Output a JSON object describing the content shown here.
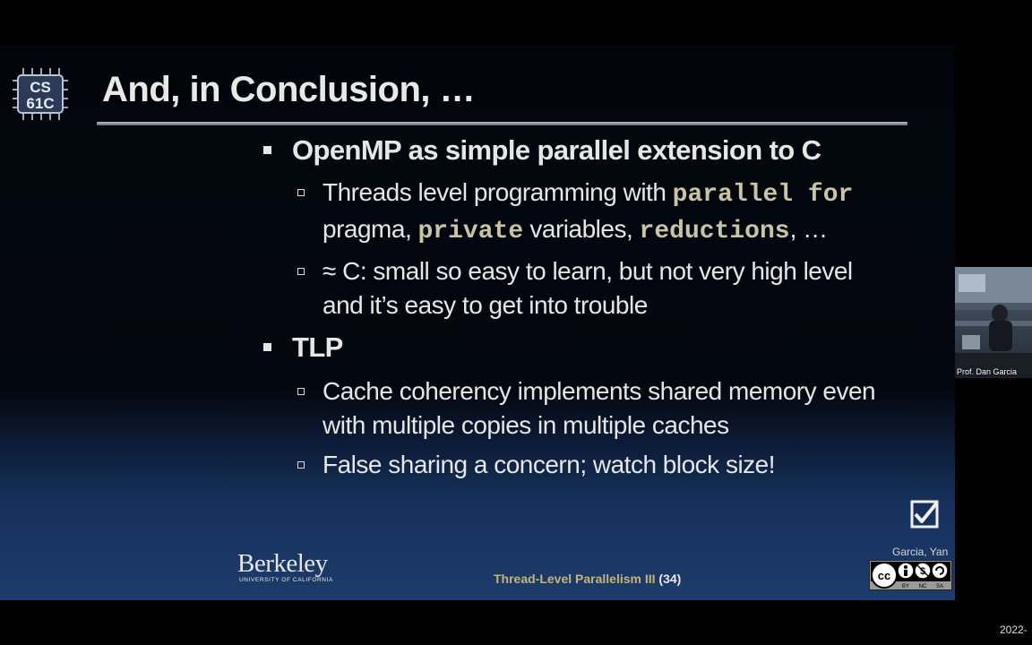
{
  "slide": {
    "logo_text_line1": "CS",
    "logo_text_line2": "61C",
    "title": "And, in Conclusion, …",
    "bullets": {
      "openmp": {
        "text": "OpenMP as simple parallel extension to C",
        "threads": {
          "part1": "Threads level programming with ",
          "code_parallel_for": "parallel for",
          "part2": " pragma, ",
          "code_private": "private",
          "part3": " variables, ",
          "code_reductions": "reductions",
          "part4": ", …"
        },
        "approx": "≈ C: small so easy to learn, but not very high level and it’s easy to get into trouble"
      },
      "tlp": {
        "text": "TLP",
        "cache": "Cache coherency implements shared memory even with multiple copies in multiple caches",
        "false_sharing": "False sharing a concern; watch block size!"
      }
    },
    "checkbox_glyph": "☑",
    "berkeley_name": "Berkeley",
    "berkeley_sub": "UNIVERSITY OF CALIFORNIA",
    "footer_title": "Thread-Level Parallelism III",
    "footer_page": "(34)",
    "authors": "Garcia, Yan",
    "cc_labels": [
      "BY",
      "NC",
      "SA"
    ]
  },
  "webcam": {
    "label": "Prof. Dan Garcia"
  },
  "timestamp": "2022-",
  "colors": {
    "text": "#e6e6e6",
    "code": "#c9c4a3",
    "footer_title": "#c7b27a",
    "slide_bottom": "#1d3c6c"
  }
}
